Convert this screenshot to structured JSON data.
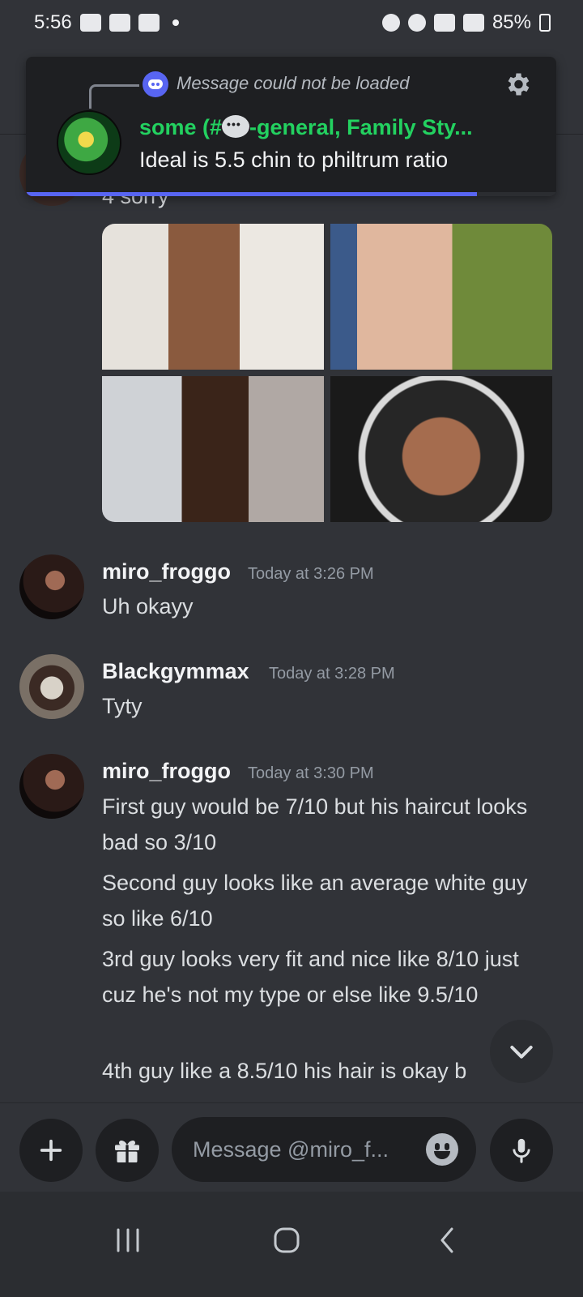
{
  "status_bar": {
    "time": "5:56",
    "battery": "85%"
  },
  "notification": {
    "reply_label": "Message could not be loaded",
    "title": "some (#",
    "title_suffix": "-general, Family Sty...",
    "body": "Ideal is 5.5 chin to philtrum ratio",
    "progress": 0.85
  },
  "partial_message": {
    "text": "4 sorry"
  },
  "messages": [
    {
      "author": "miro_froggo",
      "time": "Today at 3:26 PM",
      "lines": [
        "Uh okayy"
      ]
    },
    {
      "author": "Blackgymmax",
      "time": "Today at 3:28 PM",
      "lines": [
        "Tyty"
      ]
    },
    {
      "author": "miro_froggo",
      "time": "Today at 3:30 PM",
      "lines": [
        "First guy would be 7/10 but his haircut looks bad so 3/10",
        "Second guy looks like an average white guy so like 6/10",
        "3rd guy looks very fit and nice like 8/10 just cuz he's not my type or else like 9.5/10",
        "4th guy like a 8.5/10 his hair is okay b"
      ]
    }
  ],
  "composer": {
    "placeholder": "Message @miro_f..."
  },
  "icons": {
    "discord": "discord-logo-icon",
    "gear": "gear-icon",
    "scroll": "chevron-down-icon",
    "add": "plus-icon",
    "gift": "gift-icon",
    "emoji": "emoji-icon",
    "mic": "microphone-icon",
    "recents": "recents-icon",
    "home": "home-icon",
    "back": "back-icon"
  },
  "colors": {
    "accent": "#5865f2",
    "channel_green": "#23d160",
    "background": "#313338"
  }
}
